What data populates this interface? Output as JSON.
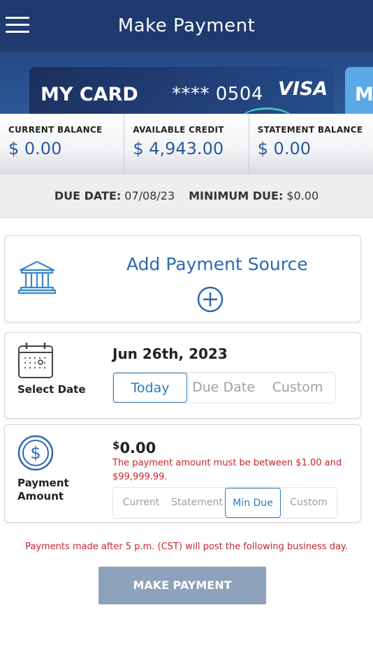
{
  "header": {
    "title": "Make Payment",
    "menu_icon": "hamburger-icon"
  },
  "cards": [
    {
      "name": "MY CARD",
      "number": "**** 0504",
      "brand": "VISA"
    },
    {
      "name": "M"
    }
  ],
  "balances": [
    {
      "label": "CURRENT BALANCE",
      "value": "$ 0.00"
    },
    {
      "label": "AVAILABLE CREDIT",
      "value": "$ 4,943.00"
    },
    {
      "label": "STATEMENT BALANCE",
      "value": "$ 0.00"
    }
  ],
  "due": {
    "due_label": "DUE DATE:",
    "due_value": "07/08/23",
    "min_label": "MINIMUM DUE:",
    "min_value": "$0.00"
  },
  "source": {
    "title": "Add Payment Source",
    "icon": "bank-icon",
    "plus_icon": "plus-circle-icon"
  },
  "date": {
    "label": "Select Date",
    "value": "Jun 26th, 2023",
    "icon": "calendar-icon",
    "options": [
      "Today",
      "Due Date",
      "Custom"
    ],
    "selected": "Today"
  },
  "amount": {
    "label_line1": "Payment",
    "label_line2": "Amount",
    "currency": "$",
    "value": "0.00",
    "icon": "dollar-circle-icon",
    "error": "The payment amount must be between $1.00 and $99,999.99.",
    "options": [
      "Current",
      "Statement",
      "Min Due",
      "Custom"
    ],
    "selected": "Min Due"
  },
  "note": "Payments made after 5 p.m. (CST) will post the following business day.",
  "button": {
    "label": "MAKE PAYMENT"
  },
  "colors": {
    "header": "#1f3a6e",
    "accent": "#2c69b0",
    "error": "#c1272d",
    "button": "#8fa2bb"
  }
}
